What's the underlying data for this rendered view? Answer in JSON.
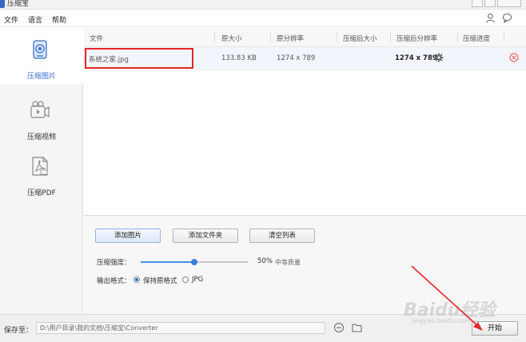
{
  "window": {
    "title": "压缩宝"
  },
  "menu": {
    "items": [
      "文件",
      "语言",
      "帮助"
    ]
  },
  "sidebar": {
    "items": [
      {
        "label": "压缩图片",
        "icon": "image-compress-icon",
        "active": true
      },
      {
        "label": "压缩视频",
        "icon": "video-compress-icon",
        "active": false
      },
      {
        "label": "压缩PDF",
        "icon": "pdf-compress-icon",
        "active": false
      }
    ]
  },
  "table": {
    "headers": [
      "文件",
      "原大小",
      "原分辨率",
      "压缩后大小",
      "压缩后分辨率",
      "压缩进度"
    ],
    "rows": [
      {
        "file": "系统之家.jpg",
        "original_size": "133.83 KB",
        "original_resolution": "1274 x 789",
        "compressed_size": "",
        "compressed_resolution": "1274 x 789",
        "progress": ""
      }
    ]
  },
  "actions": {
    "add_image": "添加图片",
    "add_folder": "添加文件夹",
    "clear_list": "清空列表"
  },
  "settings": {
    "compression_label": "压缩强度：",
    "compression_value": "50%",
    "compression_quality": "中等质量",
    "compression_level": 0.5,
    "format_label": "输出格式：",
    "format_options": [
      "保持原格式",
      "JPG"
    ],
    "format_selected": "保持原格式"
  },
  "status": {
    "save_label": "保存至：",
    "save_path": "D:\\用户目录\\我的文档\\压缩宝\\Converter",
    "start_button": "开始"
  },
  "watermark": {
    "main": "Baidu经验",
    "sub": "jingyan.baidu.com"
  },
  "colors": {
    "accent": "#3b6fd1",
    "highlight": "#e5262a",
    "slider": "#3b7fdc"
  }
}
